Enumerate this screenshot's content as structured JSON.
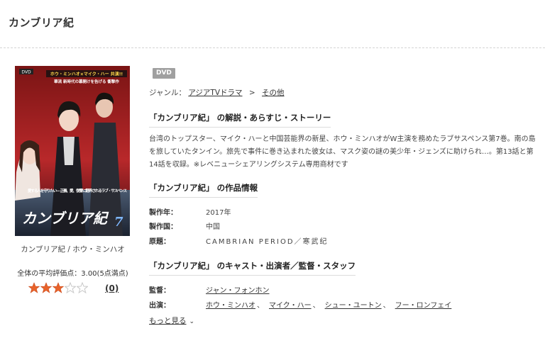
{
  "page": {
    "title": "カンブリア紀"
  },
  "product": {
    "cover_caption": "カンブリア紀 / ホウ・ミンハオ",
    "cover_text": {
      "top_label": "DVD",
      "top_tagline": "ホウ・ミンハオ×マイク・ハー 共演!!",
      "sub_tagline": "華流 新時代の幕開けを告げる 衝撃作",
      "side_tagline": "愛する人を守りたい— 正義、愛、復讐に翻弄されるラブ・サスペンス",
      "logo": "カンブリア紀",
      "volume": "7"
    },
    "rating_text": "全体の平均評価点：3.00(5点満点)",
    "rating_value": 3,
    "rating_max": 5,
    "review_count": "(0)"
  },
  "badge": "DVD",
  "genre": {
    "label": "ジャンル：",
    "primary": "アジアTVドラマ",
    "separator": ">",
    "secondary": "その他"
  },
  "sections": {
    "synopsis_title": "「カンブリア紀」 の解説・あらすじ・ストーリー",
    "info_title": "「カンブリア紀」 の作品情報",
    "cast_title": "「カンブリア紀」 のキャスト・出演者／監督・スタッフ"
  },
  "synopsis": "台湾のトップスター、マイク・ハーと中国芸能界の新星、ホウ・ミンハオがW主演を務めたラブサスペンス第7巻。南の島を旅していたタンイン。旅先で事件に巻き込まれた彼女は、マスク姿の謎の美少年・ジェンズに助けられ…。第13話と第14話を収録。※レベニューシェアリングシステム専用商材です",
  "info": {
    "year_label": "製作年：",
    "year_value": "2017年",
    "country_label": "製作国：",
    "country_value": "中国",
    "original_label": "原題：",
    "original_value": "CAMBRIAN PERIOD／寒武纪"
  },
  "cast": {
    "director_label": "監督：",
    "director": "ジャン・フォンホン",
    "actors_label": "出演：",
    "actors": [
      "ホウ・ミンハオ",
      "マイク・ハー",
      "シュー・ユートン",
      "フー・ロンフェイ"
    ],
    "separator": "、"
  },
  "more_label": "もっと見る",
  "colors": {
    "star_filled": "#e8632b",
    "star_empty": "#c8c8c8",
    "badge": "#a0a0a0"
  }
}
